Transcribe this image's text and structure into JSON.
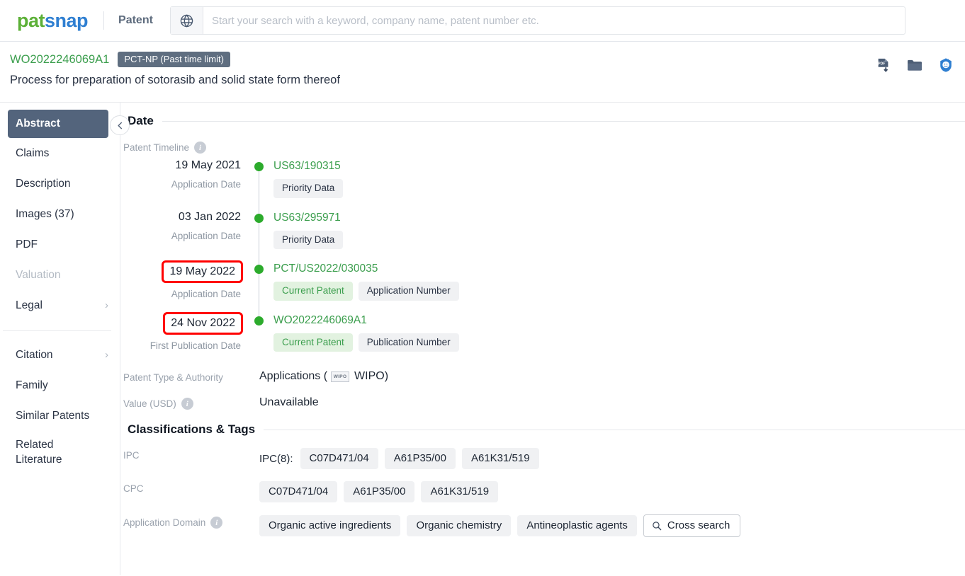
{
  "topbar": {
    "logo_pat": "pat",
    "logo_snap": "snap",
    "module": "Patent",
    "globe_icon": "globe-icon",
    "search_placeholder": "Start your search with a keyword, company name, patent number etc.",
    "search_value": ""
  },
  "patent_header": {
    "number": "WO2022246069A1",
    "status": "PCT-NP (Past time limit)",
    "title": "Process for preparation of sotorasib and solid state form thereof",
    "icons": [
      "pdf-download-icon",
      "folder-icon",
      "analysis-badge-icon"
    ]
  },
  "sidebar": {
    "items": [
      {
        "label": "Abstract",
        "active": true,
        "chevron": false,
        "disabled": false
      },
      {
        "label": "Claims",
        "active": false,
        "chevron": false,
        "disabled": false
      },
      {
        "label": "Description",
        "active": false,
        "chevron": false,
        "disabled": false
      },
      {
        "label": "Images (37)",
        "active": false,
        "chevron": false,
        "disabled": false
      },
      {
        "label": "PDF",
        "active": false,
        "chevron": false,
        "disabled": false
      },
      {
        "label": "Valuation",
        "active": false,
        "chevron": false,
        "disabled": true
      },
      {
        "label": "Legal",
        "active": false,
        "chevron": true,
        "disabled": false
      }
    ],
    "items2": [
      {
        "label": "Citation",
        "chevron": true
      },
      {
        "label": "Family",
        "chevron": false
      },
      {
        "label": "Similar Patents",
        "chevron": false
      }
    ],
    "related_line1": "Related",
    "related_line2": "Literature",
    "collapse_icon": "chevron-left-icon"
  },
  "date_section": {
    "heading": "Date",
    "timeline_label": "Patent Timeline",
    "timeline_info_icon": "info-icon",
    "entries": [
      {
        "date": "19 May 2021",
        "highlighted": false,
        "sublabel": "Application Date",
        "code": "US63/190315",
        "chips": [
          {
            "text": "Priority Data",
            "green": false
          }
        ]
      },
      {
        "date": "03 Jan 2022",
        "highlighted": false,
        "sublabel": "Application Date",
        "code": "US63/295971",
        "chips": [
          {
            "text": "Priority Data",
            "green": false
          }
        ]
      },
      {
        "date": "19 May 2022",
        "highlighted": true,
        "sublabel": "Application Date",
        "code": "PCT/US2022/030035",
        "chips": [
          {
            "text": "Current Patent",
            "green": true
          },
          {
            "text": "Application Number",
            "green": false
          }
        ]
      },
      {
        "date": "24 Nov 2022",
        "highlighted": true,
        "sublabel": "First Publication Date",
        "code": "WO2022246069A1",
        "chips": [
          {
            "text": "Current Patent",
            "green": true
          },
          {
            "text": "Publication Number",
            "green": false
          }
        ]
      }
    ],
    "type_label": "Patent Type & Authority",
    "type_value_pre": "Applications (",
    "type_badge": "WIPO",
    "type_value_post": "WIPO)",
    "value_label": "Value (USD)",
    "value_info_icon": "info-icon",
    "value_value": "Unavailable"
  },
  "classifications_section": {
    "heading": "Classifications & Tags",
    "ipc_label": "IPC",
    "ipc_prefix": "IPC(8):",
    "ipc_tags": [
      "C07D471/04",
      "A61P35/00",
      "A61K31/519"
    ],
    "cpc_label": "CPC",
    "cpc_tags": [
      "C07D471/04",
      "A61P35/00",
      "A61K31/519"
    ],
    "domain_label": "Application Domain",
    "domain_info_icon": "info-icon",
    "domain_tags": [
      "Organic active ingredients",
      "Organic chemistry",
      "Antineoplastic agents"
    ],
    "cross_search_label": "Cross search",
    "cross_search_icon": "search-icon"
  },
  "colors": {
    "logo_green": "#5cb037",
    "logo_blue": "#2f7fd1",
    "link_green": "#3b9e4d",
    "highlight_red": "#ff0000",
    "timeline_dot": "#2cab2c",
    "sidebar_active": "#53647c",
    "badge_gray": "#5f6e80"
  }
}
